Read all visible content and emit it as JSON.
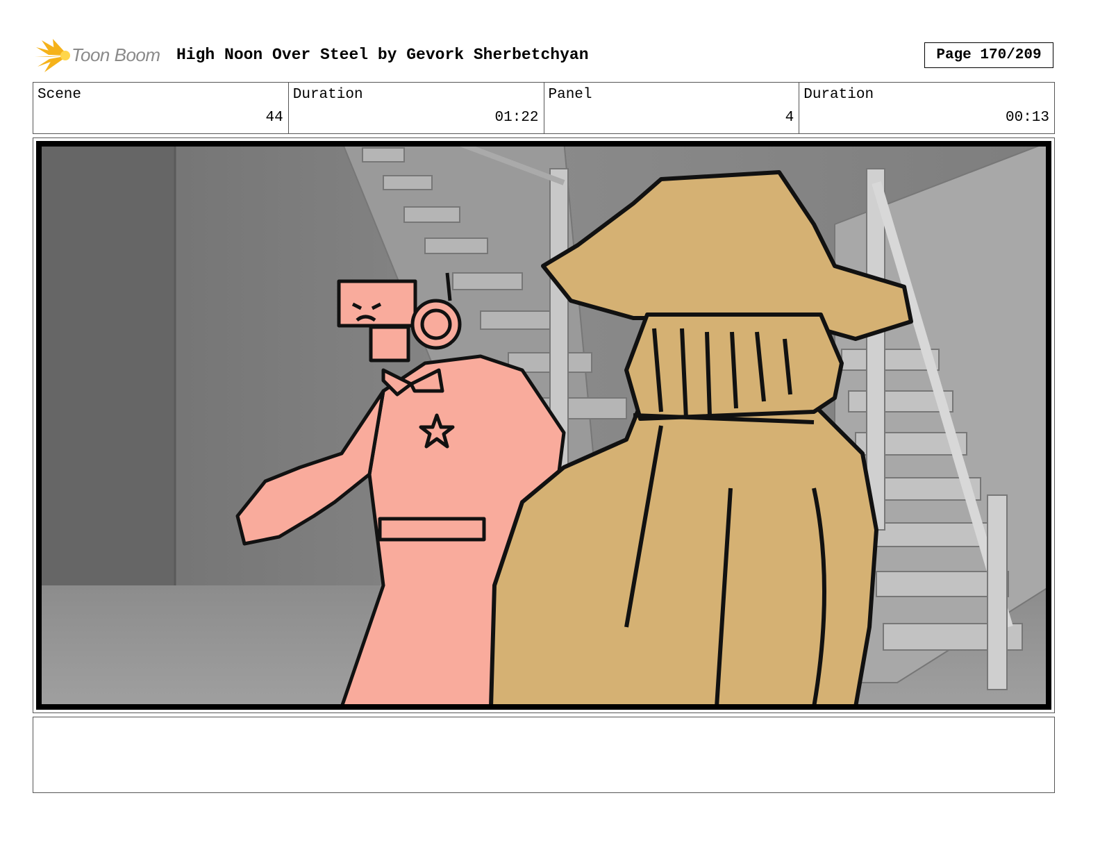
{
  "header": {
    "logo_text": "Toon Boom",
    "title": "High Noon Over Steel by Gevork Sherbetchyan",
    "page_label": "Page 170/209"
  },
  "info": {
    "scene_label": "Scene",
    "scene_value": "44",
    "scene_duration_label": "Duration",
    "scene_duration_value": "01:22",
    "panel_label": "Panel",
    "panel_value": "4",
    "panel_duration_label": "Duration",
    "panel_duration_value": "00:13"
  },
  "colors": {
    "robot_fill": "#f9ab9c",
    "cowboy_fill": "#d5b173",
    "background_gray": "#7a7a7a",
    "logo_yellow": "#f5b21a"
  },
  "notes": {
    "text": ""
  }
}
